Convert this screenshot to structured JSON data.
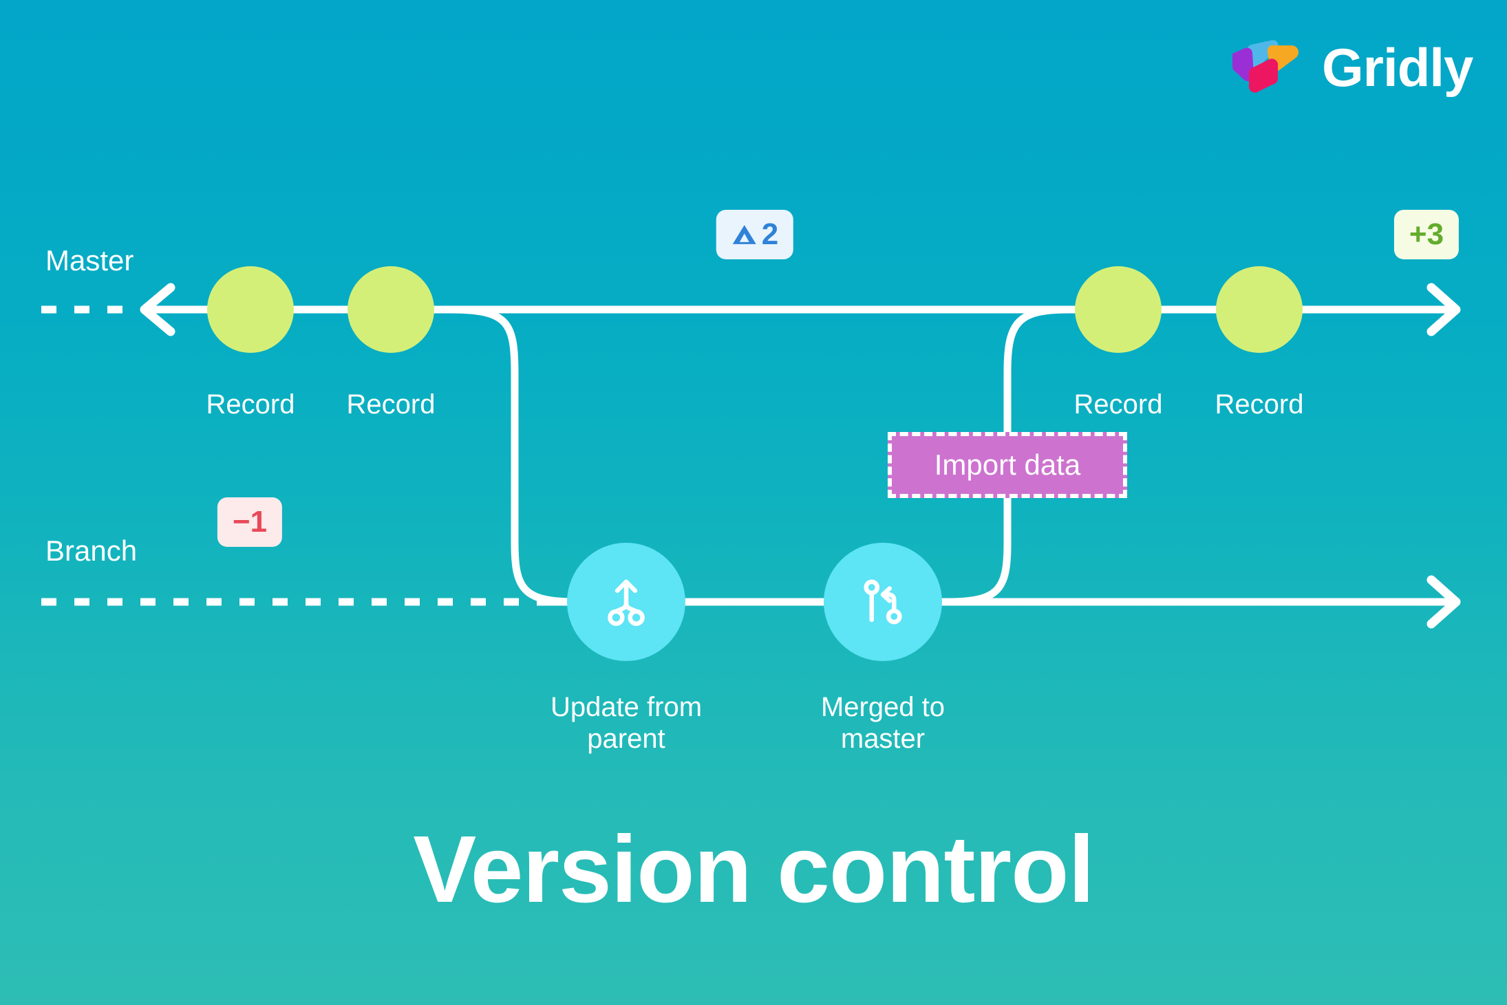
{
  "brand": {
    "name": "Gridly",
    "logo_icon": "gridly-cube-logo-icon",
    "colors": {
      "blue": "#4fb8e8",
      "orange": "#f7a823",
      "purple": "#9b2fd6",
      "pink": "#ec1760"
    }
  },
  "background": {
    "gradient_top": "#03a6c8",
    "gradient_bottom": "#2dbdb5"
  },
  "title": "Version control",
  "lanes": [
    {
      "id": "master",
      "label": "Master"
    },
    {
      "id": "branch",
      "label": "Branch"
    }
  ],
  "rail_color": "#ffffff",
  "nodes": {
    "master": [
      {
        "id": "record-1",
        "label": "Record",
        "kind": "record",
        "color": "#d4ef78"
      },
      {
        "id": "record-2",
        "label": "Record",
        "kind": "record",
        "color": "#d4ef78"
      },
      {
        "id": "record-3",
        "label": "Record",
        "kind": "record",
        "color": "#d4ef78"
      },
      {
        "id": "record-4",
        "label": "Record",
        "kind": "record",
        "color": "#d4ef78"
      }
    ],
    "branch": [
      {
        "id": "update-from-parent",
        "label": "Update from\nparent",
        "kind": "action",
        "icon": "branch-merge-up-icon",
        "color": "#5de4f5"
      },
      {
        "id": "merged-to-master",
        "label": "Merged to\nmaster",
        "kind": "action",
        "icon": "pull-request-merge-icon",
        "color": "#5de4f5"
      }
    ]
  },
  "badges": [
    {
      "id": "delta",
      "icon": "triangle-up-icon",
      "value": "2",
      "text_color": "#2f82d8",
      "background": "#eaf4fd"
    },
    {
      "id": "plus",
      "value": "+3",
      "text_color": "#63ac2c",
      "background": "#f6fbe4"
    },
    {
      "id": "minus",
      "value": "−1",
      "text_color": "#e8495a",
      "background": "#fdeaea"
    }
  ],
  "import_box": {
    "label": "Import data",
    "fill": "#cd73cf",
    "border_style": "dashed",
    "border_color": "#ffffff"
  }
}
